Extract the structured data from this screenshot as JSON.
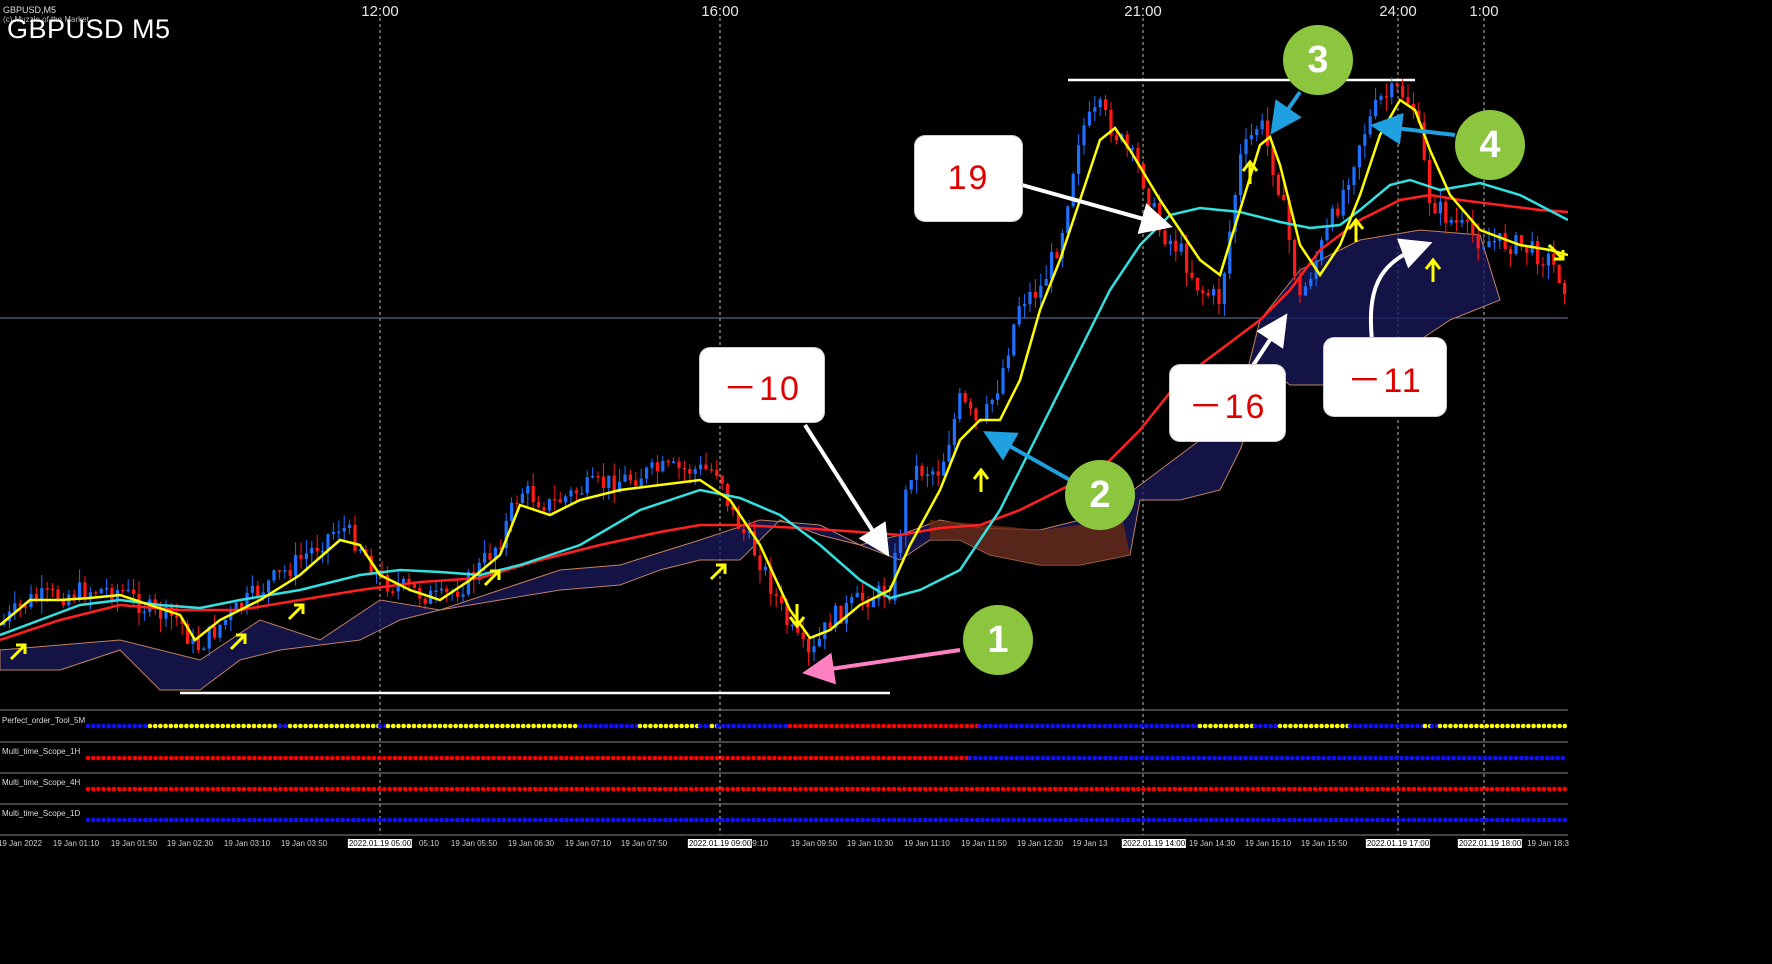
{
  "window": {
    "symbol_small": "GBPUSD,M5",
    "copyright": "(c) Muzzle of the Market",
    "title": "GBPUSD M5"
  },
  "time_axis_top": [
    "12:00",
    "16:00",
    "21:00",
    "24:00",
    "1:00"
  ],
  "callouts": {
    "c1": "－10",
    "c2": "19",
    "c3": "－16",
    "c4": "－11"
  },
  "badges": [
    "1",
    "2",
    "3",
    "4"
  ],
  "panels": [
    {
      "label": "Perfect_order_Tool_5M"
    },
    {
      "label": "Multi_time_Scope_1H"
    },
    {
      "label": "Multi_time_Scope_4H"
    },
    {
      "label": "Multi_time_Scope_1D"
    }
  ],
  "date_axis": [
    {
      "text": "19 Jan 2022",
      "hl": false
    },
    {
      "text": "19 Jan 01:10",
      "hl": false
    },
    {
      "text": "19 Jan 01:50",
      "hl": false
    },
    {
      "text": "19 Jan 02:30",
      "hl": false
    },
    {
      "text": "19 Jan 03:10",
      "hl": false
    },
    {
      "text": "19 Jan 03:50",
      "hl": false
    },
    {
      "text": "2022.01.19 05:00",
      "hl": true
    },
    {
      "text": "05:10",
      "hl": false
    },
    {
      "text": "19 Jan 05:50",
      "hl": false
    },
    {
      "text": "19 Jan 06:30",
      "hl": false
    },
    {
      "text": "19 Jan 07:10",
      "hl": false
    },
    {
      "text": "19 Jan 07:50",
      "hl": false
    },
    {
      "text": "2022.01.19 09:00",
      "hl": true
    },
    {
      "text": "09:10",
      "hl": false
    },
    {
      "text": "19 Jan 09:50",
      "hl": false
    },
    {
      "text": "19 Jan 10:30",
      "hl": false
    },
    {
      "text": "19 Jan 11:10",
      "hl": false
    },
    {
      "text": "19 Jan 11:50",
      "hl": false
    },
    {
      "text": "19 Jan 12:30",
      "hl": false
    },
    {
      "text": "19 Jan 13",
      "hl": false
    },
    {
      "text": "2022.01.19 14:00",
      "hl": true
    },
    {
      "text": "19 Jan 14:30",
      "hl": false
    },
    {
      "text": "19 Jan 15:10",
      "hl": false
    },
    {
      "text": "19 Jan 15:50",
      "hl": false
    },
    {
      "text": "2022.01.19 17:00",
      "hl": true
    },
    {
      "text": "2022.01.19 18:00",
      "hl": true
    },
    {
      "text": "19 Jan 18:3",
      "hl": false
    }
  ],
  "colors": {
    "background": "#000000",
    "bull_candle": "#1f6fff",
    "bear_candle": "#ff1a1a",
    "ma_fast": "#ffff00",
    "ma_mid": "#33e0e0",
    "ma_slow": "#ff2020",
    "cloud_bull": "#3a3aa0",
    "cloud_bear": "#c0602a",
    "callout_text": "#e00000",
    "badge": "#8cc63f",
    "arrow_pink": "#ff80c0",
    "arrow_blue": "#1fa0e0",
    "signal_arrow": "#ffff00",
    "dot_blue": "#1010ff",
    "dot_red": "#ff0000",
    "dot_yellow": "#ffff00"
  }
}
